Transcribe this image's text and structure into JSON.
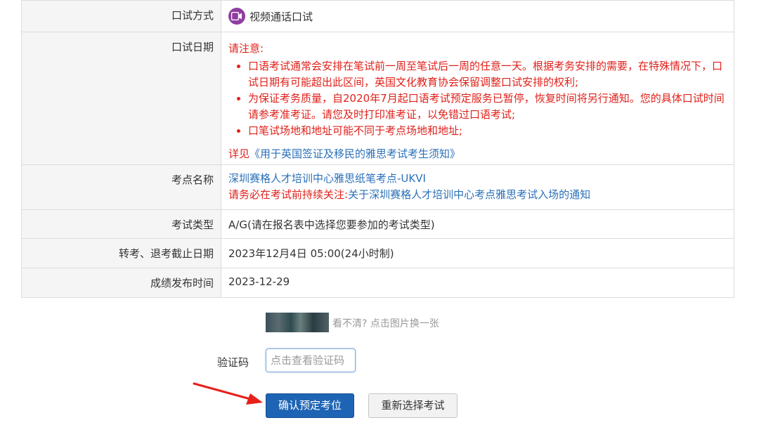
{
  "rows": {
    "oral_method": {
      "label": "口试方式",
      "value": "视频通话口试"
    },
    "oral_date": {
      "label": "口试日期",
      "notice_title": "请注意:",
      "notices": [
        "口语考试通常会安排在笔试前一周至笔试后一周的任意一天。根据考务安排的需要，在特殊情况下，口试日期有可能超出此区间，英国文化教育协会保留调整口试安排的权利;",
        "为保证考务质量，自2020年7月起口语考试预定服务已暂停，恢复时间将另行通知。您的具体口试时间请参考准考证。请您及时打印准考证，以免错过口语考试;",
        "口笔试场地和地址可能不同于考点场地和地址;"
      ],
      "detail_prefix": "详见",
      "detail_link": "《用于英国签证及移民的雅思考试考生须知》"
    },
    "venue": {
      "label": "考点名称",
      "value": "深圳赛格人才培训中心雅思纸笔考点-UKVI",
      "notice_prefix": "请务必在考试前持续关注:",
      "notice_link": "关于深圳赛格人才培训中心考点雅思考试入场的通知"
    },
    "exam_type": {
      "label": "考试类型",
      "value": "A/G(请在报名表中选择您要参加的考试类型)"
    },
    "deadline": {
      "label": "转考、退考截止日期",
      "value": "2023年12月4日 05:00(24小时制)"
    },
    "result_date": {
      "label": "成绩发布时间",
      "value": "2023-12-29"
    }
  },
  "captcha": {
    "hint": "看不清?  点击图片换一张",
    "label": "验证码",
    "placeholder": "点击查看验证码"
  },
  "buttons": {
    "confirm": "确认预定考位",
    "reselect": "重新选择考试"
  },
  "colors": {
    "notice_red": "#e0211b",
    "link_blue": "#2b70b8",
    "primary_button": "#1e64b4"
  },
  "icons": {
    "oral_method": "video-camera-icon",
    "annotation": "red-arrow"
  }
}
